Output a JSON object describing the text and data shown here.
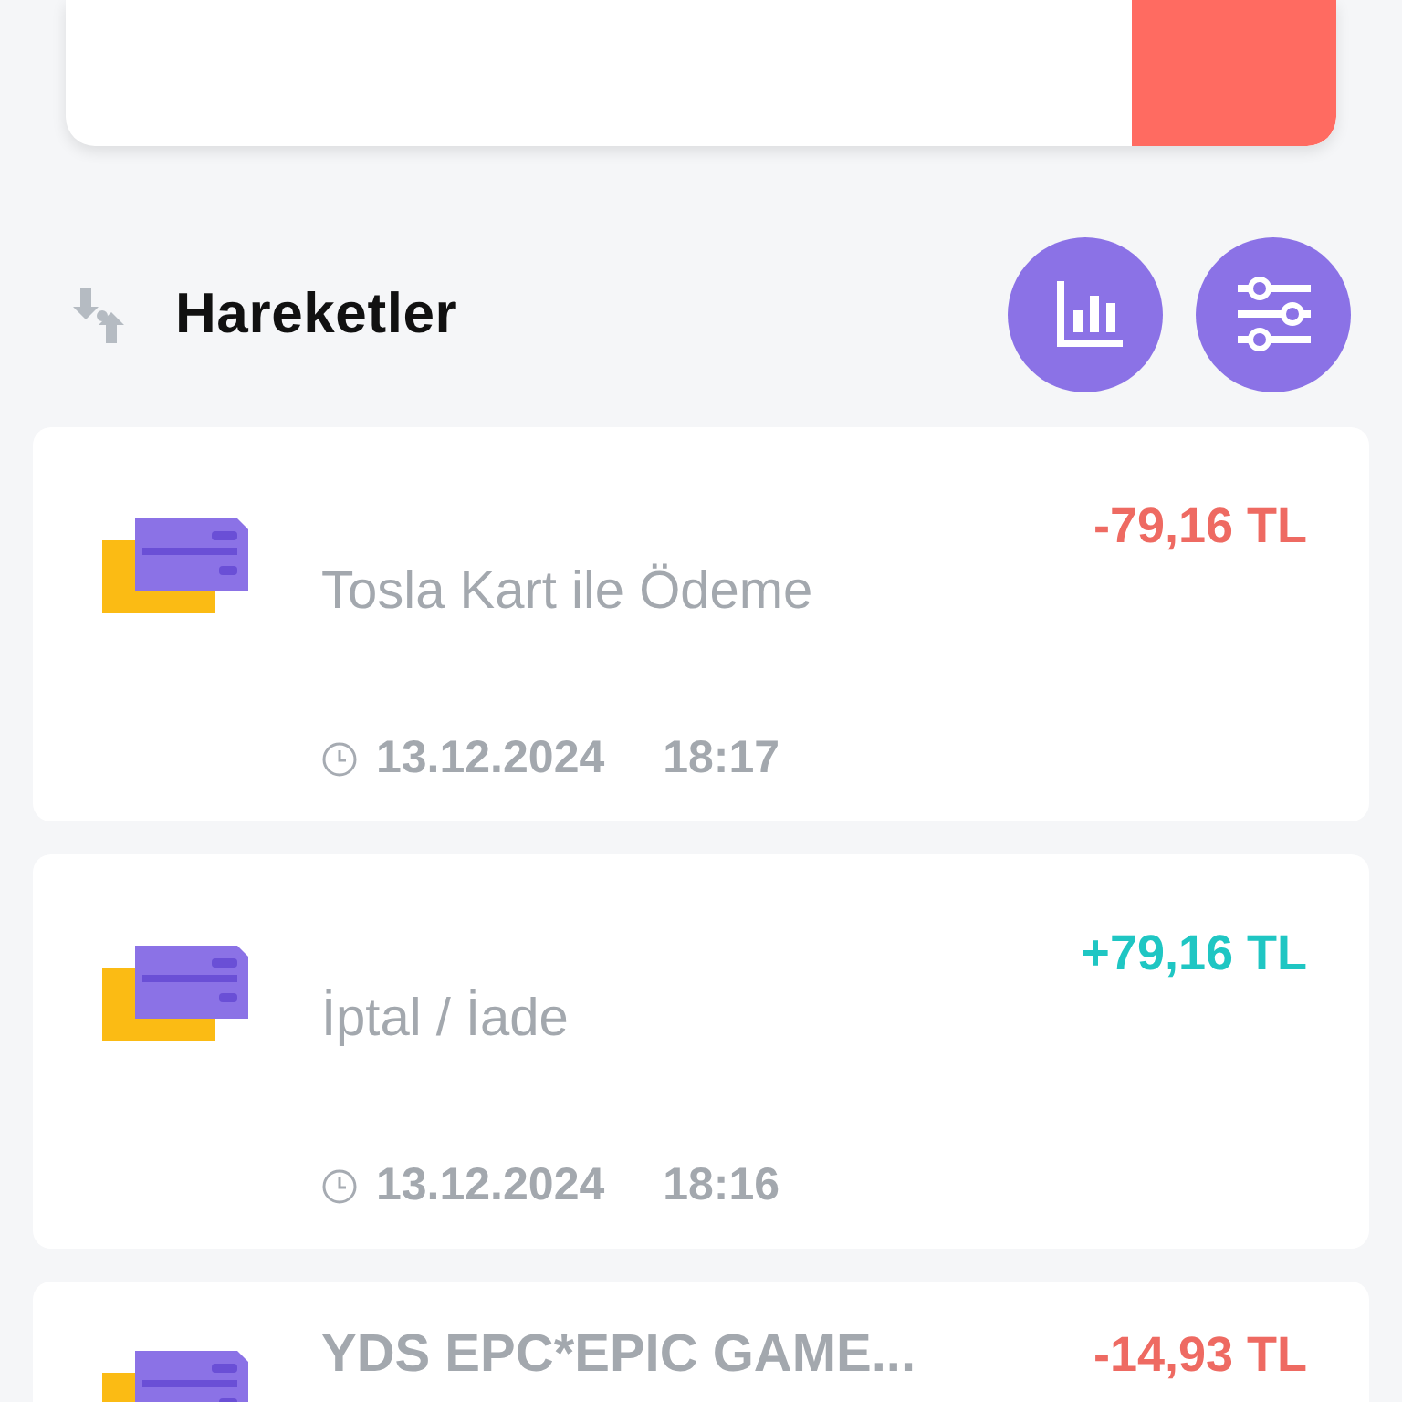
{
  "section": {
    "title": "Hareketler"
  },
  "transactions": [
    {
      "kind": "generic",
      "title": "Tosla Kart ile Ödeme",
      "amount": "-79,16 TL",
      "incoming": false,
      "date": "13.12.2024",
      "time": "18:17"
    },
    {
      "kind": "generic",
      "title": "İptal / İade",
      "amount": "+79,16 TL",
      "incoming": true,
      "date": "13.12.2024",
      "time": "18:16"
    },
    {
      "kind": "merchant",
      "title": "YDS EPC*EPIC GAME...",
      "amount": "-14,93 TL",
      "incoming": false
    }
  ]
}
